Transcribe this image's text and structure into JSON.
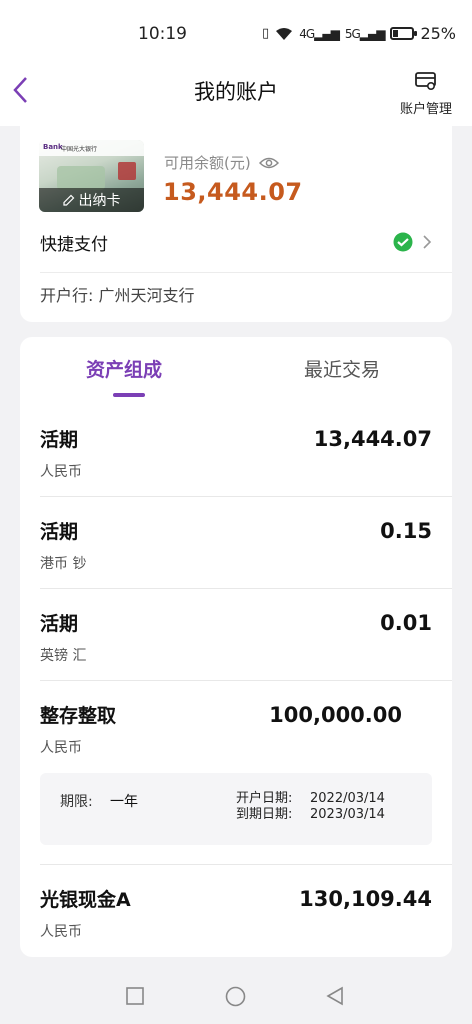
{
  "status_bar": {
    "time": "10:19",
    "network": "4G",
    "network2": "5G",
    "battery_pct": "25%",
    "battery_level": 0.25
  },
  "header": {
    "title": "我的账户",
    "account_mgmt_label": "账户管理"
  },
  "card": {
    "bank_logo": "Bank",
    "bank_name": "中国光大银行",
    "overlay_label": "出纳卡",
    "balance_label": "可用余额(元)",
    "balance_value": "13,444.07",
    "quick_pay_label": "快捷支付",
    "branch": "开户行:  广州天河支行"
  },
  "tabs": [
    {
      "label": "资产组成",
      "active": true
    },
    {
      "label": "最近交易",
      "active": false
    }
  ],
  "assets": [
    {
      "name": "活期",
      "currency": "人民币",
      "amount": "13,444.07"
    },
    {
      "name": "活期",
      "currency": "港币 钞",
      "amount": "0.15"
    },
    {
      "name": "活期",
      "currency": "英镑 汇",
      "amount": "0.01"
    },
    {
      "name": "整存整取",
      "currency": "人民币",
      "amount": "100,000.00"
    },
    {
      "name": "光银现金A",
      "currency": "人民币",
      "amount": "130,109.44"
    }
  ],
  "term": {
    "term_label": "期限:",
    "term_value": "一年",
    "open_date_label": "开户日期:",
    "open_date": "2022/03/14",
    "due_date_label": "到期日期:",
    "due_date": "2023/03/14"
  },
  "colors": {
    "accent": "#7b3fb5",
    "balance": "#c65a1e",
    "wechat": "#2bb44b"
  }
}
